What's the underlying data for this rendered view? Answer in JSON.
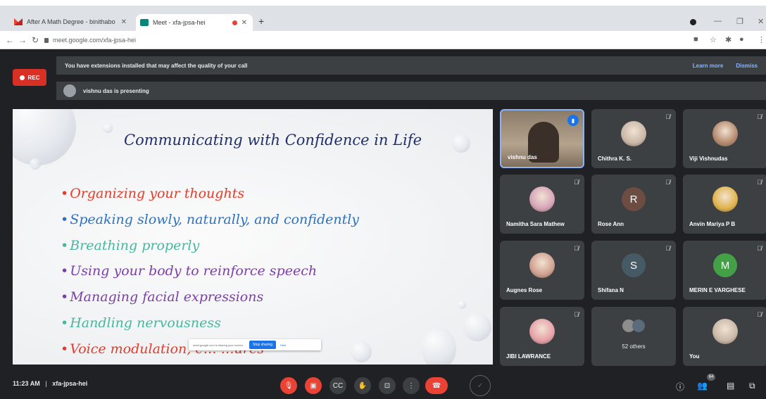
{
  "browser": {
    "tabs": [
      {
        "title": "After A Math Degree - binithabo",
        "active": false
      },
      {
        "title": "Meet - xfa-jpsa-hei",
        "active": true
      }
    ],
    "url": "meet.google.com/xfa-jpsa-hei"
  },
  "meet": {
    "rec_label": "REC",
    "extension_banner": "You have extensions installed that may affect the quality of your call",
    "learn_more": "Learn more",
    "dismiss": "Dismiss",
    "presenting_banner": "vishnu das is presenting",
    "share_notice": "meet.google.com is sharing your screen.",
    "stop_sharing": "Stop sharing",
    "hide": "Hide"
  },
  "slide": {
    "title": "Communicating with Confidence in Life",
    "bullets": [
      {
        "text": "Organizing your thoughts",
        "color": "#e53b2a"
      },
      {
        "text": "Speaking slowly, naturally, and confidently",
        "color": "#2a72c4"
      },
      {
        "text": "Breathing properly",
        "color": "#47b7a0"
      },
      {
        "text": "Using your body to reinforce speech",
        "color": "#7b3fa8"
      },
      {
        "text": "Managing facial expressions",
        "color": "#7b3fa8"
      },
      {
        "text": "Handling nervousness",
        "color": "#47b7a0"
      },
      {
        "text": "Voice modulation, e… …ures",
        "color": "#e53b2a"
      }
    ]
  },
  "participants": [
    {
      "name": "vishnu das",
      "type": "video",
      "speaking": true
    },
    {
      "name": "Chithra K. S.",
      "type": "photo",
      "muted": true
    },
    {
      "name": "Viji Vishnudas",
      "type": "photo",
      "muted": true
    },
    {
      "name": "Namitha Sara Mathew",
      "type": "photo",
      "muted": true
    },
    {
      "name": "Rose Ann",
      "type": "letter",
      "letter": "R",
      "color": "#6d4c41",
      "muted": true
    },
    {
      "name": "Anvin Mariya P B",
      "type": "photo",
      "muted": true
    },
    {
      "name": "Augnes Rose",
      "type": "photo",
      "muted": true
    },
    {
      "name": "Shifana N",
      "type": "letter",
      "letter": "S",
      "color": "#455a64",
      "muted": true
    },
    {
      "name": "MERIN E VARGHESE",
      "type": "letter",
      "letter": "M",
      "color": "#43a047",
      "muted": true
    },
    {
      "name": "JIBI LAWRANCE",
      "type": "photo",
      "muted": true
    },
    {
      "name": "52 others",
      "type": "others"
    },
    {
      "name": "You",
      "type": "photo",
      "muted": true
    }
  ],
  "bottom": {
    "time": "11:23 AM",
    "separator": "|",
    "code": "xfa-jpsa-hei",
    "participant_count": "64"
  }
}
